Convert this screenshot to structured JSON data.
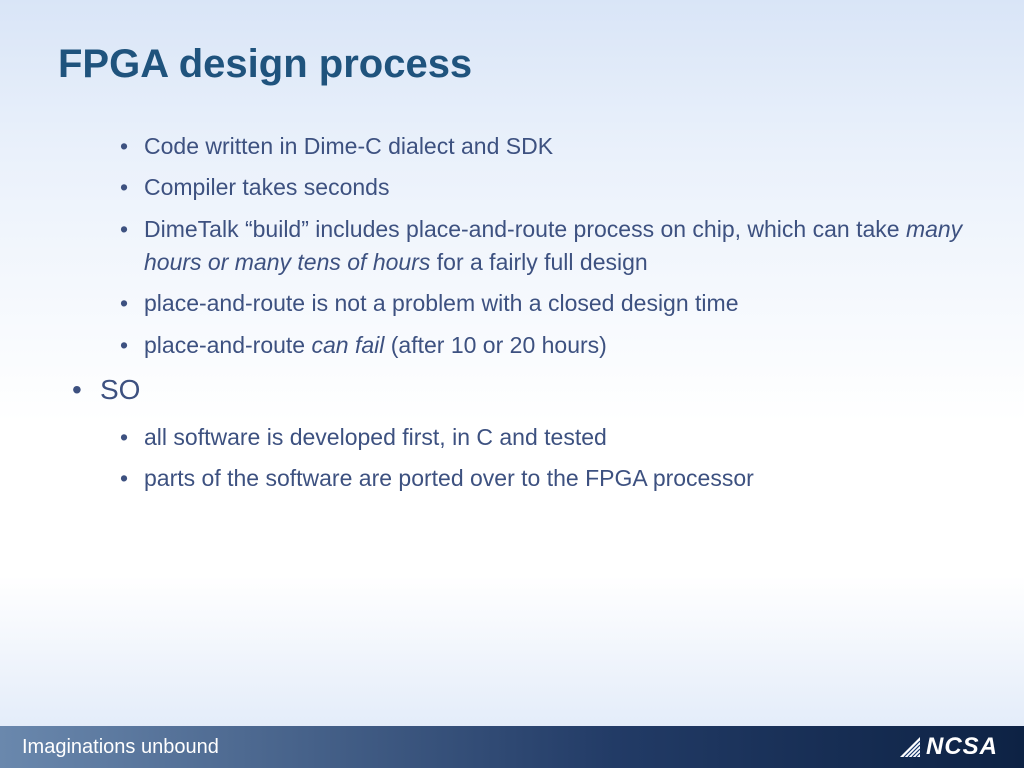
{
  "title": "FPGA design process",
  "bullets": {
    "b1": "Code written in Dime-C dialect and SDK",
    "b2": "Compiler takes seconds",
    "b3_pre": "DimeTalk “build” includes place-and-route process on chip, which can take ",
    "b3_em": "many hours or many tens of hours",
    "b3_post": " for a fairly full design",
    "b4": "place-and-route is not a problem with a closed design time",
    "b5_pre": "place-and-route ",
    "b5_em": "can fail",
    "b5_post": " (after 10 or 20 hours)",
    "so": "SO",
    "b6": "all software is developed first, in C and tested",
    "b7": "parts of the software are ported over to the FPGA processor"
  },
  "footer": {
    "tagline": "Imaginations unbound",
    "logo_text": "NCSA"
  }
}
